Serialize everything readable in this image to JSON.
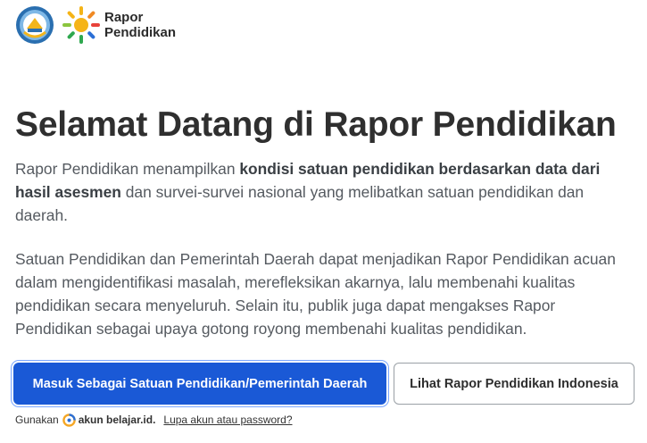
{
  "header": {
    "brand_line1": "Rapor",
    "brand_line2": "Pendidikan"
  },
  "hero": {
    "title": "Selamat Datang di Rapor Pendidikan",
    "para1_a": "Rapor Pendidikan menampilkan ",
    "para1_bold": "kondisi satuan pendidikan berdasarkan data dari hasil asesmen",
    "para1_b": " dan survei-survei nasional yang melibatkan satuan pendidikan dan daerah.",
    "para2": "Satuan Pendidikan dan Pemerintah Daerah dapat menjadikan Rapor Pendidikan acuan dalam mengidentifikasi masalah, merefleksikan akarnya, lalu membenahi kualitas pendidikan secara menyeluruh. Selain itu, publik juga dapat mengakses Rapor Pendidikan sebagai upaya gotong royong membenahi kualitas pendidikan."
  },
  "actions": {
    "login_label": "Masuk Sebagai Satuan Pendidikan/Pemerintah Daerah",
    "view_label": "Lihat Rapor Pendidikan Indonesia"
  },
  "footer": {
    "use_text": "Gunakan",
    "account_text": "akun belajar.id.",
    "forgot_text": "Lupa akun atau password?"
  },
  "colors": {
    "primary": "#1a59d6",
    "text_dark": "#2f2f2f",
    "text_body": "#555a60"
  }
}
